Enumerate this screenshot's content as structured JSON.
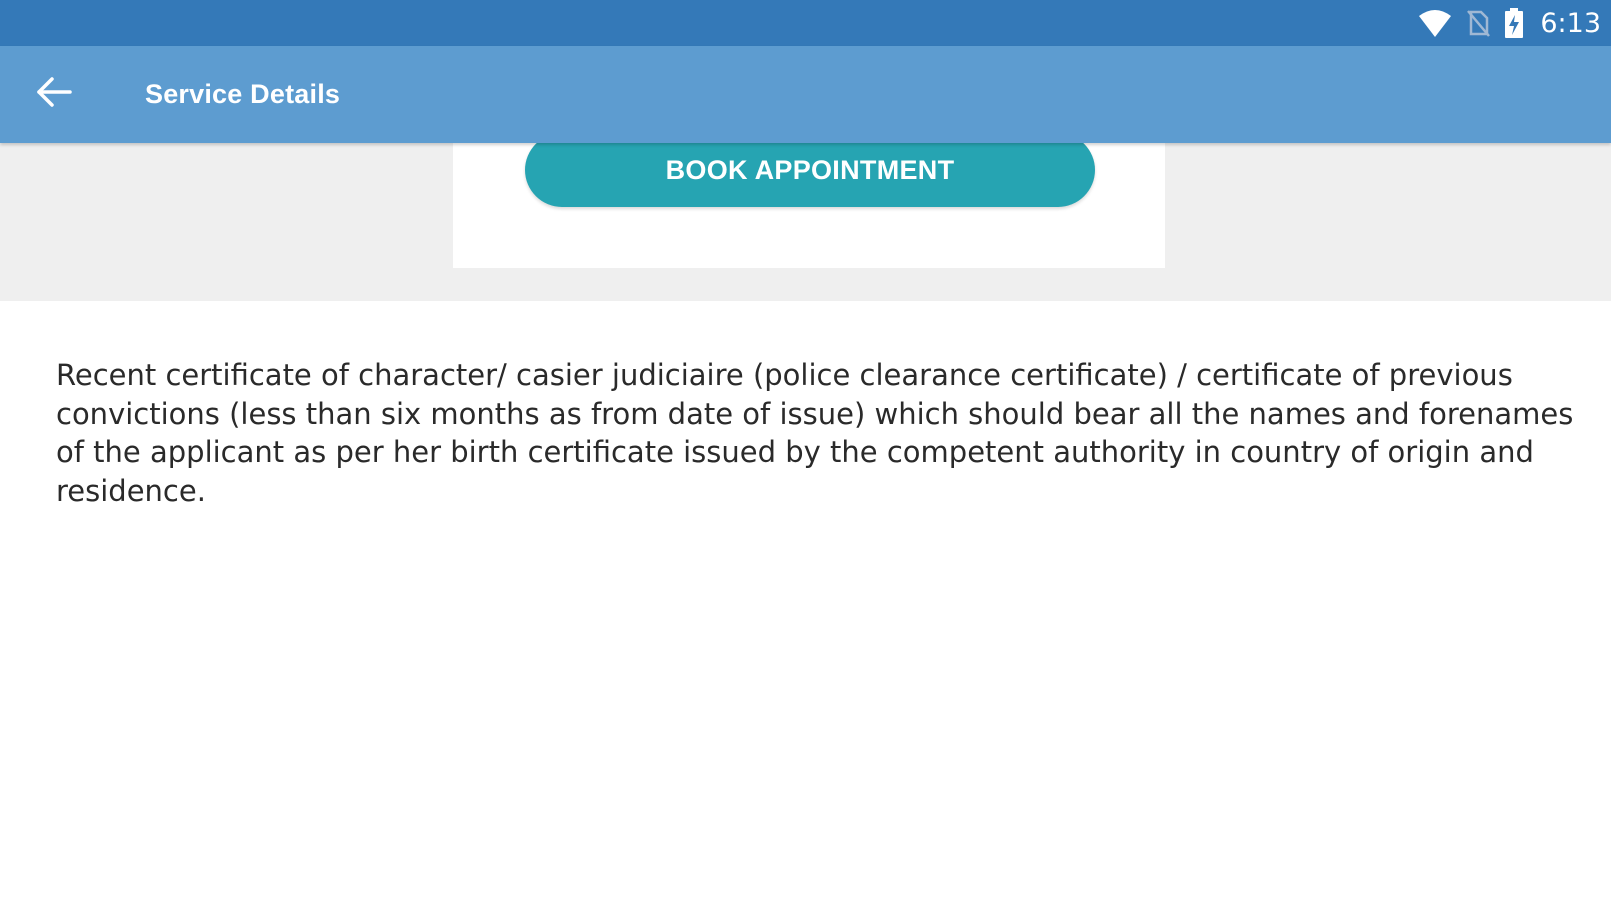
{
  "status_bar": {
    "time": "6:13",
    "icons": [
      "wifi-icon",
      "no-sim-icon",
      "battery-charging-icon"
    ],
    "background": "#3479b8"
  },
  "app_bar": {
    "title": "Service Details",
    "back_icon": "arrow-left-icon",
    "background": "#5d9cd0"
  },
  "card": {
    "button_label": "BOOK APPOINTMENT",
    "button_color": "#26a4b2"
  },
  "content": {
    "description": "Recent certificate of character/ casier judiciaire (police clearance certificate) / certificate of previous convictions (less than six months as from date of issue) which should bear all the names and forenames of the applicant as per her birth certificate issued by the competent authority in country of origin and residence."
  }
}
